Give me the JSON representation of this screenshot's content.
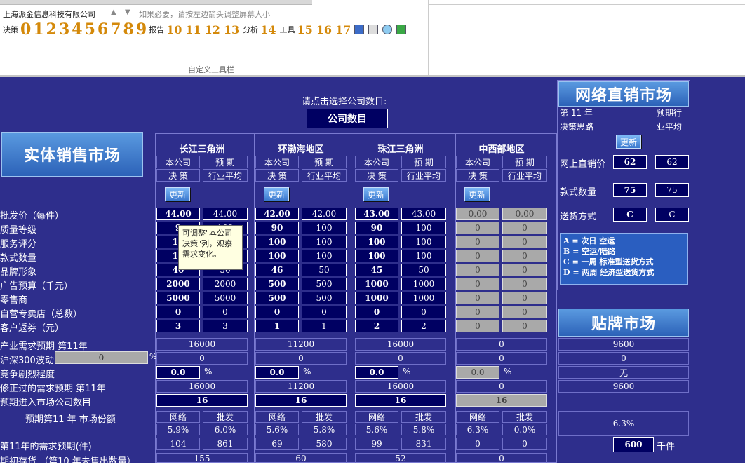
{
  "toolbar": {
    "company": "上海派金信息科技有限公司",
    "hint": "如果必要，请按左边箭头调整屏幕大小",
    "decision_label": "决策",
    "decision_numbers": [
      "0",
      "1",
      "2",
      "3",
      "4",
      "5",
      "6",
      "7",
      "8",
      "9"
    ],
    "report_label": "报告",
    "report_numbers": [
      "10",
      "11",
      "12",
      "13"
    ],
    "analysis_label": "分析",
    "analysis_numbers": [
      "14"
    ],
    "tools_label": "工具",
    "tools_numbers": [
      "15",
      "16",
      "17"
    ],
    "caption": "自定义工具栏"
  },
  "main": {
    "select_prompt": "请点击选择公司数目:",
    "company_count_button": "公司数目",
    "physical_market_title": "实体销售市场",
    "online_market_title": "网络直销市场",
    "oem_market_title": "贴牌市场",
    "update_label": "更新",
    "col_headers": {
      "company": "本公司",
      "decision": "决 策",
      "forecast": "预 期",
      "industry_avg": "行业平均"
    },
    "tooltip": "可调整\"本公司决策\"列，观察需求变化。",
    "row_labels": [
      "批发价（每件）",
      "质量等级",
      "服务评分",
      "款式数量",
      "品牌形象",
      "广告预算（千元）",
      "零售商",
      "自营专卖店（总数）",
      "客户返券（元）"
    ],
    "lower_labels": [
      "产业需求预期 第11年",
      "沪深300波动",
      "竞争剧烈程度",
      "修正过的需求预期 第11年",
      "预期进入市场公司数目",
      "预期第11 年 市场份额",
      "第11年的需求预期(件)",
      "期初存货 （第10 年未售出数量）"
    ],
    "hs300_value": "0",
    "pct": "%",
    "regions": [
      {
        "name": "长江三角洲",
        "company": [
          "44.00",
          "9",
          "10",
          "10",
          "40",
          "2000",
          "5000",
          "0",
          "3"
        ],
        "avg": [
          "44.00",
          "100",
          "100",
          "100",
          "50",
          "2000",
          "5000",
          "0",
          "3"
        ],
        "demand": "16000",
        "hs300": "0",
        "competition": "0.0",
        "corrected": "16000",
        "firms": "16",
        "net": "网络",
        "wholesale": "批发",
        "share_net": "5.9%",
        "share_wh": "6.0%",
        "need_net": "104",
        "need_wh": "861",
        "inventory": "155",
        "gray": false
      },
      {
        "name": "环渤海地区",
        "company": [
          "42.00",
          "90",
          "100",
          "100",
          "46",
          "500",
          "500",
          "0",
          "1"
        ],
        "avg": [
          "42.00",
          "100",
          "100",
          "100",
          "50",
          "500",
          "500",
          "0",
          "1"
        ],
        "demand": "11200",
        "hs300": "0",
        "competition": "0.0",
        "corrected": "11200",
        "firms": "16",
        "net": "网络",
        "wholesale": "批发",
        "share_net": "5.6%",
        "share_wh": "5.8%",
        "need_net": "69",
        "need_wh": "580",
        "inventory": "60",
        "gray": false
      },
      {
        "name": "珠江三角洲",
        "company": [
          "43.00",
          "90",
          "100",
          "100",
          "45",
          "1000",
          "1000",
          "0",
          "2"
        ],
        "avg": [
          "43.00",
          "100",
          "100",
          "100",
          "50",
          "1000",
          "1000",
          "0",
          "2"
        ],
        "demand": "16000",
        "hs300": "0",
        "competition": "0.0",
        "corrected": "16000",
        "firms": "16",
        "net": "网络",
        "wholesale": "批发",
        "share_net": "5.6%",
        "share_wh": "5.8%",
        "need_net": "99",
        "need_wh": "831",
        "inventory": "52",
        "gray": false
      },
      {
        "name": "中西部地区",
        "company": [
          "0.00",
          "0",
          "0",
          "0",
          "0",
          "0",
          "0",
          "0",
          "0"
        ],
        "avg": [
          "0.00",
          "0",
          "0",
          "0",
          "0",
          "0",
          "0",
          "0",
          "0"
        ],
        "demand": "0",
        "hs300": "0",
        "competition": "0.0",
        "corrected": "0",
        "firms": "16",
        "net": "网络",
        "wholesale": "批发",
        "share_net": "6.3%",
        "share_wh": "0.0%",
        "need_net": "0",
        "need_wh": "0",
        "inventory": "0",
        "gray": true
      }
    ],
    "online": {
      "year_label": "第 11 年",
      "decision_idea": "决策思路",
      "forecast_label": "预期行",
      "industry_avg_label": "业平均",
      "price_label": "网上直销价",
      "price": "62",
      "price_avg": "62",
      "styles_label": "款式数量",
      "styles": "75",
      "styles_avg": "75",
      "delivery_label": "送货方式",
      "delivery": "C",
      "delivery_avg": "C",
      "legend": [
        "A = 次日 空运",
        "B = 空运/陆路",
        "C = 一周 标准型送货方式",
        "D = 两周 经济型送货方式"
      ]
    },
    "oem": {
      "demand": "9600",
      "hs300": "0",
      "competition": "无",
      "corrected": "9600",
      "share": "6.3%",
      "need": "600",
      "unit": "千件"
    }
  }
}
